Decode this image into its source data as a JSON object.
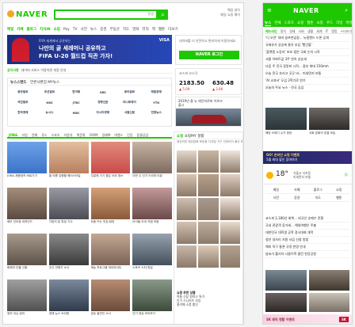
{
  "desktop": {
    "logo": "NAVER",
    "search_shortcut": "한영",
    "top_links": [
      "웨일 설치",
      "메일 쇼핑 페이"
    ],
    "gnb": [
      "메일",
      "카페",
      "블로그",
      "지식iN",
      "쇼핑",
      "Pay",
      "TV",
      "사전",
      "뉴스",
      "증권",
      "부동산",
      "지도",
      "영화",
      "뮤직",
      "책",
      "웹툰",
      "더보기"
    ],
    "banner": {
      "kicker": "FIFA 세계에서 공유하는",
      "line1": "나만의 골 세레머니 공유하고",
      "line2": "FIFA U-20 월드컵 직관 가자!",
      "brand": "VISA"
    },
    "login": {
      "msg": "네이버를 더 안전하고 편리하게 이용하세요",
      "button": "NAVER 로그인"
    },
    "notice": {
      "label": "공지사항",
      "text": "네이버 서비스 이용약관 개정 안내"
    },
    "news": {
      "tabs": [
        "뉴스스탠드",
        "언론사편집",
        "MY뉴스"
      ],
      "press": [
        "중앙일보",
        "조선일보",
        "한겨레",
        "SBS",
        "동아일보",
        "매일경제",
        "국민일보",
        "KBS",
        "JTBC",
        "경향신문",
        "머니투데이",
        "YTN",
        "한국경제",
        "뉴시스",
        "MBC",
        "아시아경제",
        "서울신문",
        "연합뉴스"
      ]
    },
    "stock": {
      "label": "코스피 코스닥",
      "kospi": "2183.50",
      "kosdaq": "630.48",
      "kospi_chg": "▲ 5.09",
      "kosdaq_chg": "▲ 2.80"
    },
    "ad": {
      "text": "2019년 올 뉴 레인지로버 이보크 출시"
    },
    "content_tabs": [
      "JOB&",
      "리빙",
      "연예",
      "푸드",
      "스포츠",
      "자동차",
      "책문화",
      "FARM",
      "경제M",
      "여행+",
      "건강",
      "동물공감"
    ],
    "tiles": [
      {
        "cap": "JOB& 채용정보 바로가기",
        "c1": "#3b73c9",
        "c2": "#6da2e8"
      },
      {
        "cap": "올 여름 유행할 헤어스타일",
        "c1": "#b6805e",
        "c2": "#e4bea0"
      },
      {
        "cap": "주말에 가기 좋은 야외 명소",
        "c1": "#c84a4a",
        "c2": "#e28b7c"
      },
      {
        "cap": "이번 주 인기 드라마 리뷰",
        "c1": "#7d6a5e",
        "c2": "#c8b4a4"
      },
      {
        "cap": "배우 인터뷰 비하인드",
        "c1": "#5a4a40",
        "c2": "#a58e7c"
      },
      {
        "cap": "가정의 달 특집 기사",
        "c1": "#4c4c54",
        "c2": "#9a9aa4"
      },
      {
        "cap": "요즘 뜨는 맛집 탐방",
        "c1": "#8a5a3a",
        "c2": "#d4a078"
      },
      {
        "cap": "아이돌 무대 직캠 모음",
        "c1": "#6b4a4a",
        "c2": "#c49a9a"
      },
      {
        "cap": "화제의 인물 근황",
        "c1": "#5c5248",
        "c2": "#a89a8c"
      },
      {
        "cap": "주간 연예가 소식",
        "c1": "#3a3a3a",
        "c2": "#8a8a8a"
      },
      {
        "cap": "예능 프로그램 하이라이트",
        "c1": "#7a6254",
        "c2": "#c2a894"
      },
      {
        "cap": "스포츠 스타 특집",
        "c1": "#44505c",
        "c2": "#96a2ae"
      },
      {
        "cap": "정치 이슈 정리",
        "c1": "#505050",
        "c2": "#a0a0a0"
      },
      {
        "cap": "경제 뉴스 브리핑",
        "c1": "#2f3a4a",
        "c2": "#7c8a9c"
      },
      {
        "cap": "방송 출연진 소식",
        "c1": "#6a4c3c",
        "c2": "#b88c72"
      },
      {
        "cap": "인기 영상 모아보기",
        "c1": "#3c4a3c",
        "c2": "#8a9a8a"
      }
    ],
    "shop": {
      "tabs": [
        "쇼핑",
        "쇼핑MY",
        "생활"
      ],
      "sub": "패션의류 패션잡화 화장품 디지털 가구 인테리어 출산 육아 식품",
      "colors": [
        "#e6d8cc",
        "#c9b6a4",
        "#efe6dc",
        "#d8c4b0",
        "#b8a08a",
        "#e0d0c4",
        "#cfc0b2",
        "#a89a8e",
        "#ede2d8",
        "#d4c2b2",
        "#bfae9e",
        "#e8dccf",
        "#c8b8aa",
        "#dccab8",
        "#b4a290"
      ],
      "footer_title": "쇼핑 추천 상품",
      "footer_lines": [
        "여름 신상 원피스 특가",
        "인기 스니커즈 모음",
        "홈카페 소품 할인"
      ]
    }
  },
  "mobile": {
    "logo": "NAVER",
    "tabs": [
      "뉴스",
      "연예",
      "스포츠",
      "쇼핑",
      "웹툰",
      "쇼핑",
      "푸드",
      "리빙",
      "여행"
    ],
    "menu": [
      "헤드라인",
      "정치",
      "경제",
      "사회",
      "생활",
      "세계",
      "IT",
      "랭킹",
      "+더보기"
    ],
    "headlines": [
      "'디 오픈' 대비 골프연습장... 뉴질랜드 드론 공개",
      "국제유가 상승에 물가 부담 '빨간불'",
      "'플랫폼 노동자' 보호 법안 국회 논의 시작",
      "서울 아파트값 3주 연속 상승세",
      "다음 주 전국 장맛비 시작... 중부 최대 150mm",
      "오늘 전국 흐리고 곳곳 비... 미세먼지 보통",
      "'AI 교과서' 도입 2학기로 연기",
      "오늘의 주요 뉴스 - 전국 공감"
    ],
    "photo_caps": [
      "해양 쓰레기 수거 현장",
      "국회 본회의 표결 모습"
    ],
    "banner": {
      "line1": "GO! 온라인 쇼핑 이벤트",
      "line2": "5월 최대 할인 참여하기"
    },
    "weather": {
      "temp": "18°",
      "place": "서울시 서초동",
      "desc": "미세먼지 보통"
    },
    "shortcuts": [
      "메일",
      "카페",
      "블로그",
      "쇼핑",
      "사전",
      "증권",
      "지도",
      "웹툰"
    ],
    "lower_list": [
      "코스피 2,180선 회복... 외국인 순매수 전환",
      "국내 관광객 증가세... 해외여행은 주춤",
      "대한민국 대학생 공학 경시대회 개막",
      "청년 일자리 지원 사업 신청 방법",
      "해외 직구 통관 규정 변경 안내",
      "날씨가 풀리자 나들이객 몰린 한강공원"
    ],
    "ad": {
      "text": "SK 매직 렌탈 이벤트",
      "brand": "SK"
    }
  }
}
